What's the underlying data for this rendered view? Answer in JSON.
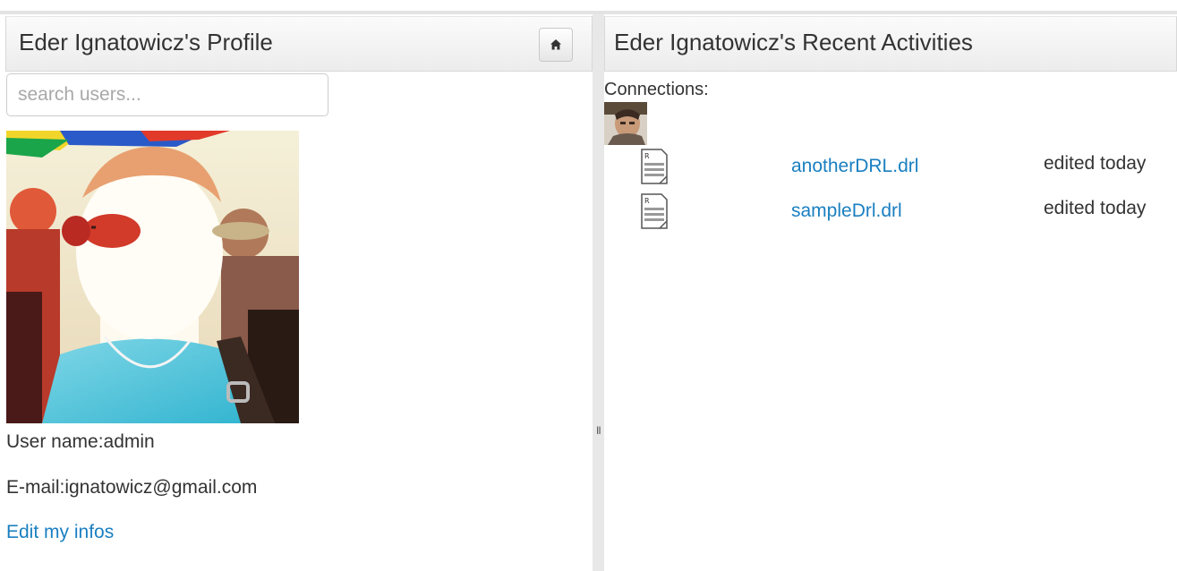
{
  "profile": {
    "title": "Eder Ignatowicz's Profile",
    "home_icon": "home-icon",
    "search": {
      "placeholder": "search users...",
      "value": ""
    },
    "user_name_line": "User name:admin",
    "email_line": "E-mail:ignatowicz@gmail.com",
    "edit_link": "Edit my infos"
  },
  "activities": {
    "title": "Eder Ignatowicz's Recent Activities",
    "connections_label": "Connections:",
    "items": [
      {
        "icon": "drl-file-icon",
        "file": "anotherDRL.drl",
        "status": "edited today"
      },
      {
        "icon": "drl-file-icon",
        "file": "sampleDrl.drl",
        "status": "edited today"
      }
    ]
  },
  "splitter": {
    "grip": "II"
  },
  "colors": {
    "link": "#1a7fc1",
    "text": "#333333",
    "header_bg": "#f2f2f2",
    "splitter": "#e8e8e8"
  }
}
